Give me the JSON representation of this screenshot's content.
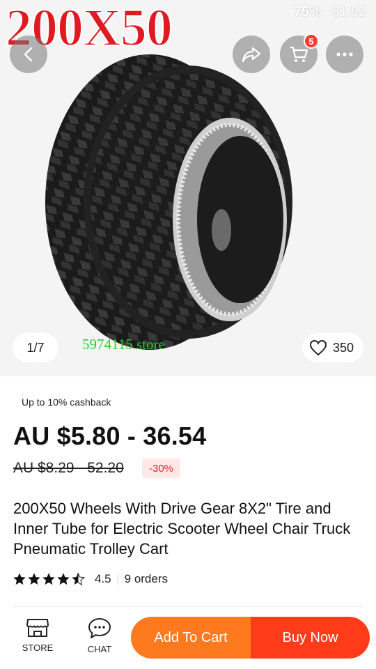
{
  "status_bar": {
    "battery": "75%",
    "time": "01:52"
  },
  "gallery": {
    "overlay_text": "200X50",
    "counter": "1/7",
    "likes": "350",
    "store_watermark": "5974115 store",
    "cart_badge": "5"
  },
  "product": {
    "cashback": "Up to 10% cashback",
    "price": "AU $5.80 - 36.54",
    "original_price": "AU $8.29 - 52.20",
    "discount": "-30%",
    "title": "200X50 Wheels With Drive Gear 8X2\" Tire and Inner Tube for Electric Scooter Wheel Chair Truck Pneumatic Trolley Cart",
    "rating": "4.5",
    "orders": "9 orders"
  },
  "bottom_bar": {
    "store_label": "STORE",
    "chat_label": "CHAT",
    "add_to_cart": "Add To Cart",
    "buy_now": "Buy Now"
  },
  "colors": {
    "add_to_cart": "#ff7a1e",
    "buy_now": "#ff3b1a",
    "discount_text": "#e6262d",
    "badge": "#ff3b30",
    "overlay_text": "#e01a22",
    "store_watermark": "#1fd12c"
  },
  "icons": [
    "back-arrow-icon",
    "share-icon",
    "cart-icon",
    "more-icon",
    "heart-icon",
    "star-icon",
    "half-star-icon",
    "store-icon",
    "chat-icon"
  ]
}
